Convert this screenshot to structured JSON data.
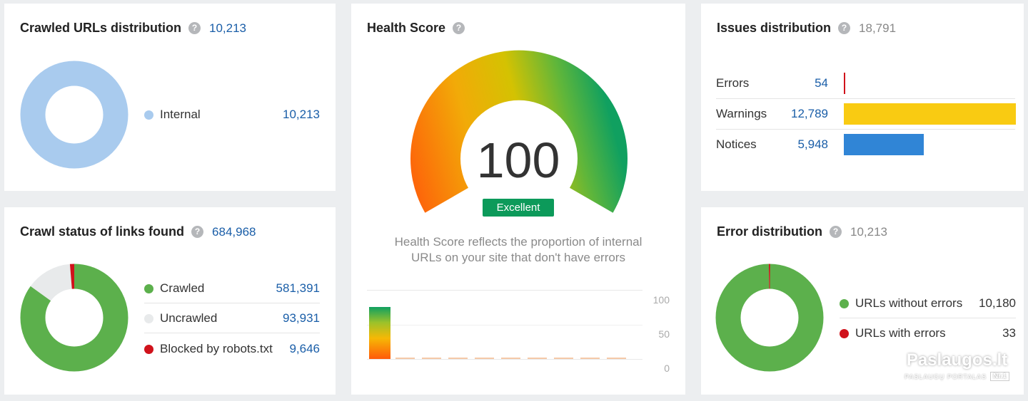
{
  "crawled": {
    "title": "Crawled URLs distribution",
    "help": "?",
    "count": "10,213",
    "legend": [
      {
        "label": "Internal",
        "value": "10,213",
        "color": "#a9cbee"
      }
    ]
  },
  "crawl_status": {
    "title": "Crawl status of links found",
    "help": "?",
    "count": "684,968",
    "legend": [
      {
        "label": "Crawled",
        "value": "581,391",
        "color": "#5cb04c"
      },
      {
        "label": "Uncrawled",
        "value": "93,931",
        "color": "#e8eaeb"
      },
      {
        "label": "Blocked by robots.txt",
        "value": "9,646",
        "color": "#d0121b"
      }
    ]
  },
  "health": {
    "title": "Health Score",
    "help": "?",
    "score": "100",
    "badge": "Excellent",
    "description_line1": "Health Score reflects the proportion of internal",
    "description_line2": "URLs on your site that don't have errors",
    "axis": [
      "100",
      "50",
      "0"
    ],
    "history_percent": 100
  },
  "issues": {
    "title": "Issues distribution",
    "help": "?",
    "count": "18,791",
    "rows": [
      {
        "label": "Errors",
        "value": "54",
        "color": "#d0121b"
      },
      {
        "label": "Warnings",
        "value": "12,789",
        "color": "#f9cb12"
      },
      {
        "label": "Notices",
        "value": "5,948",
        "color": "#3085d6"
      }
    ]
  },
  "errors": {
    "title": "Error distribution",
    "help": "?",
    "count": "10,213",
    "legend": [
      {
        "label": "URLs without errors",
        "value": "10,180",
        "color": "#5cb04c"
      },
      {
        "label": "URLs with errors",
        "value": "33",
        "color": "#d0121b"
      }
    ]
  },
  "watermark": {
    "brand": "Paslaugos.lt",
    "sub": "PASLAUGŲ PORTALAS",
    "tag": "Nr.1"
  }
}
